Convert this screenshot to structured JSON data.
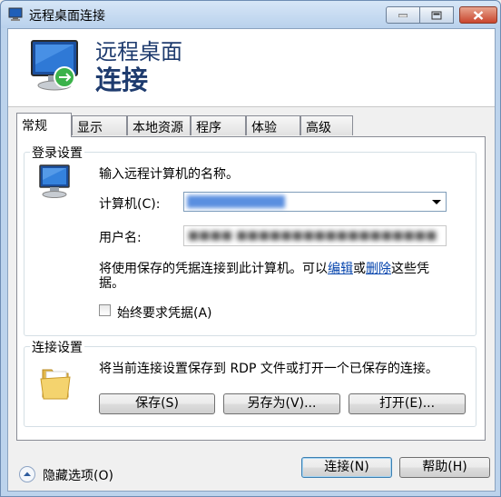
{
  "window": {
    "title": "远程桌面连接"
  },
  "banner": {
    "line1": "远程桌面",
    "line2": "连接"
  },
  "tabs": [
    {
      "label": "常规",
      "active": true
    },
    {
      "label": "显示",
      "active": false
    },
    {
      "label": "本地资源",
      "active": false
    },
    {
      "label": "程序",
      "active": false
    },
    {
      "label": "体验",
      "active": false
    },
    {
      "label": "高级",
      "active": false
    }
  ],
  "login": {
    "group_label": "登录设置",
    "prompt": "输入远程计算机的名称。",
    "computer_label": "计算机(C):",
    "username_label": "用户名:",
    "info_text_1": "将使用保存的凭据连接到此计算机。可以",
    "edit_link": "编辑",
    "info_or": "或",
    "delete_link": "删除",
    "info_text_2": "这些凭",
    "info_text_3": "据。",
    "always_ask_label": "始终要求凭据(A)"
  },
  "connection": {
    "group_label": "连接设置",
    "description": "将当前连接设置保存到 RDP 文件或打开一个已保存的连接。",
    "save_label": "保存(S)",
    "save_as_label": "另存为(V)...",
    "open_label": "打开(E)..."
  },
  "footer": {
    "hide_options_label": "隐藏选项(O)",
    "connect_label": "连接(N)",
    "help_label": "帮助(H)"
  }
}
